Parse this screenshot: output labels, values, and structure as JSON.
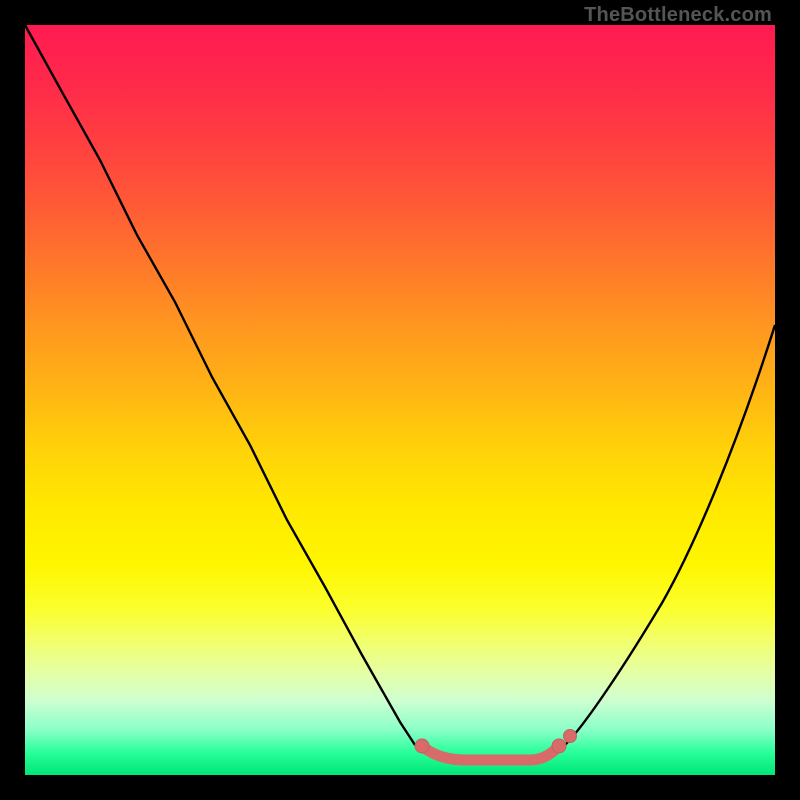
{
  "attribution": "TheBottleneck.com",
  "colors": {
    "frame": "#000000",
    "gradient_top": "#ff1a52",
    "gradient_mid": "#ffe800",
    "gradient_bottom": "#00e676",
    "curve": "#000000",
    "marker": "#d86a6a"
  },
  "chart_data": {
    "type": "line",
    "title": "",
    "xlabel": "",
    "ylabel": "",
    "xlim": [
      0,
      100
    ],
    "ylim": [
      0,
      100
    ],
    "series": [
      {
        "name": "left-branch",
        "x": [
          0,
          5,
          10,
          15,
          20,
          25,
          30,
          35,
          40,
          45,
          50,
          52
        ],
        "values": [
          100,
          91,
          82,
          72,
          63,
          53,
          44,
          34,
          25,
          16,
          7,
          4
        ]
      },
      {
        "name": "right-branch",
        "x": [
          72,
          75,
          80,
          85,
          90,
          95,
          100
        ],
        "values": [
          4,
          7,
          14,
          23,
          34,
          46,
          60
        ]
      },
      {
        "name": "flat-minimum",
        "x": [
          52,
          56,
          60,
          64,
          68,
          72
        ],
        "values": [
          4,
          2.5,
          2,
          2,
          2.5,
          4
        ]
      }
    ],
    "markers": [
      {
        "name": "min-segment-left",
        "x": 53,
        "y": 3.8
      },
      {
        "name": "min-segment-right",
        "x": 71,
        "y": 3.8
      },
      {
        "name": "min-floor-a",
        "x": 56,
        "y": 2.3
      },
      {
        "name": "min-floor-b",
        "x": 60,
        "y": 2.0
      },
      {
        "name": "min-floor-c",
        "x": 64,
        "y": 2.0
      },
      {
        "name": "min-floor-d",
        "x": 68,
        "y": 2.3
      }
    ]
  }
}
